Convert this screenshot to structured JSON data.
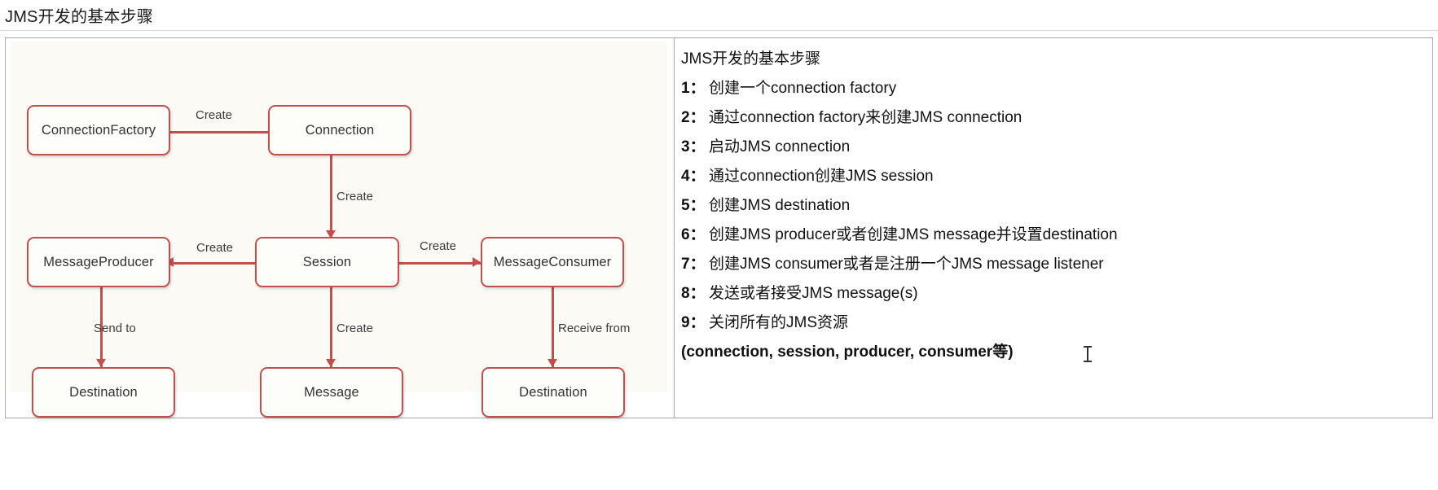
{
  "page": {
    "title": "JMS开发的基本步骤"
  },
  "diagram": {
    "nodes": {
      "connection_factory": "ConnectionFactory",
      "connection": "Connection",
      "message_producer": "MessageProducer",
      "session": "Session",
      "message_consumer": "MessageConsumer",
      "destination_left": "Destination",
      "message": "Message",
      "destination_right": "Destination"
    },
    "edge_labels": {
      "factory_to_connection": "Create",
      "connection_to_session": "Create",
      "session_to_producer": "Create",
      "session_to_consumer": "Create",
      "producer_to_destination": "Send to",
      "session_to_message": "Create",
      "consumer_from_destination": "Receive from"
    },
    "colors": {
      "accent": "#c0504d",
      "node_fill": "#fdfdfa",
      "canvas": "#fbfaf5"
    }
  },
  "steps": {
    "heading": "JMS开发的基本步骤",
    "items": [
      {
        "num": "1：",
        "text": "创建一个connection factory"
      },
      {
        "num": "2：",
        "text": "通过connection factory来创建JMS connection"
      },
      {
        "num": "3：",
        "text": "启动JMS connection"
      },
      {
        "num": "4：",
        "text": "通过connection创建JMS session"
      },
      {
        "num": "5：",
        "text": "创建JMS destination"
      },
      {
        "num": "6：",
        "text": "创建JMS producer或者创建JMS message并设置destination"
      },
      {
        "num": "7：",
        "text": "创建JMS consumer或者是注册一个JMS message listener"
      },
      {
        "num": "8：",
        "text": "发送或者接受JMS message(s)"
      },
      {
        "num": "9：",
        "text": "关闭所有的JMS资源"
      }
    ],
    "footer": "(connection, session, producer, consumer等)"
  }
}
